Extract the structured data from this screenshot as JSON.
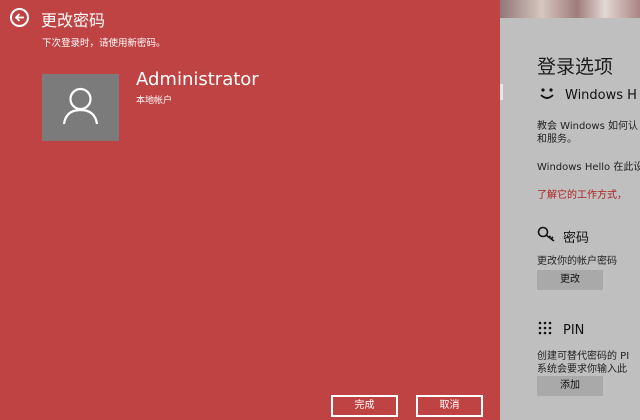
{
  "dialog": {
    "title": "更改密码",
    "subtitle": "下次登录时，请使用新密码。",
    "user_name": "Administrator",
    "account_type": "本地帐户",
    "finish_label": "完成",
    "cancel_label": "取消",
    "back_icon": "back-arrow-icon",
    "avatar_icon": "user-icon",
    "background_color": "#c04343"
  },
  "background_settings": {
    "title": "登录选项",
    "hello_heading": "Windows H",
    "hello_desc_line1": "教会 Windows 如何认",
    "hello_desc_line2": "和服务。",
    "hello_desc_line3": "Windows Hello 在此设",
    "learn_more_link": "了解它的工作方式，",
    "password_heading": "密码",
    "password_desc": "更改你的帐户密码",
    "password_button": "更改",
    "pin_heading": "PIN",
    "pin_desc_line1": "创建可替代密码的 PI",
    "pin_desc_line2": "系统会要求你输入此",
    "pin_button": "添加",
    "link_color": "#b02020"
  }
}
